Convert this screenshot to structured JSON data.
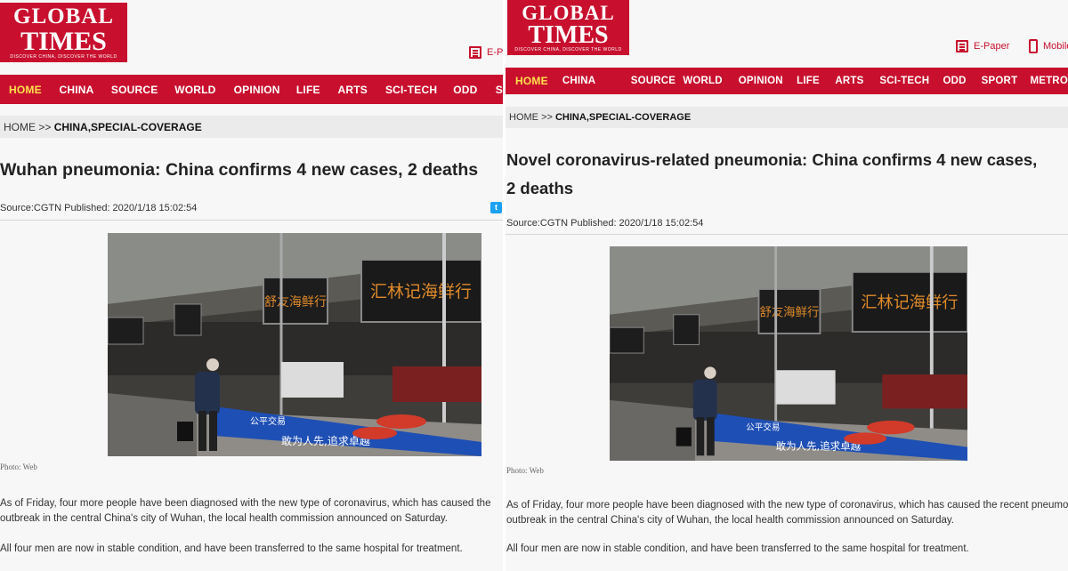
{
  "left": {
    "logo": {
      "line1": "GLOBAL",
      "line2": "TIMES",
      "tagline": "DISCOVER CHINA, DISCOVER THE WORLD"
    },
    "topright": {
      "epaper": "E-P"
    },
    "nav": [
      "HOME",
      "CHINA",
      "SOURCE",
      "WORLD",
      "OPINION",
      "LIFE",
      "ARTS",
      "SCI-TECH",
      "ODD",
      "S"
    ],
    "breadcrumb": {
      "home": "HOME",
      "sep": ">>",
      "section": "CHINA,SPECIAL-COVERAGE"
    },
    "headline": "Wuhan pneumonia: China confirms 4 new cases, 2 deaths",
    "meta": "Source:CGTN Published: 2020/1/18 15:02:54",
    "caption": "Photo: Web",
    "para1": "As of Friday, four more people have been diagnosed with the new type of coronavirus, which has caused the outbreak in the central China's city of Wuhan, the local health commission announced on Saturday.",
    "para2": "All four men are now in stable condition, and have been transferred to the same hospital for treatment."
  },
  "right": {
    "logo": {
      "line1": "GLOBAL",
      "line2": "TIMES",
      "tagline": "DISCOVER CHINA, DISCOVER THE WORLD"
    },
    "topright": {
      "epaper": "E-Paper",
      "mobile": "Mobile"
    },
    "nav": [
      "HOME",
      "CHINA",
      "SOURCE",
      "WORLD",
      "OPINION",
      "LIFE",
      "ARTS",
      "SCI-TECH",
      "ODD",
      "SPORT",
      "METRO"
    ],
    "breadcrumb": {
      "home": "HOME",
      "sep": ">>",
      "section": "CHINA,SPECIAL-COVERAGE"
    },
    "headline_line1": "Novel coronavirus-related pneumonia: China confirms 4 new cases,",
    "headline_line2": "2 deaths",
    "meta": "Source:CGTN Published: 2020/1/18 15:02:54",
    "caption": "Photo: Web",
    "para1": "As of Friday, four more people have been diagnosed with the new type of coronavirus, which has caused the recent pneumonia outbreak in the central China's city of Wuhan, the local health commission announced on Saturday.",
    "para2": "All four men are now in stable condition, and have been transferred to the same hospital for treatment."
  },
  "photo_signs": {
    "sign1": "舒友海鲜行",
    "sign2": "汇林记海鲜行",
    "banner1": "公平交易",
    "banner2": "敢为人先,追求卓越"
  },
  "colors": {
    "brand_red": "#c8102e",
    "nav_active": "#ffe14d",
    "breadcrumb_bg": "#ebebeb"
  }
}
